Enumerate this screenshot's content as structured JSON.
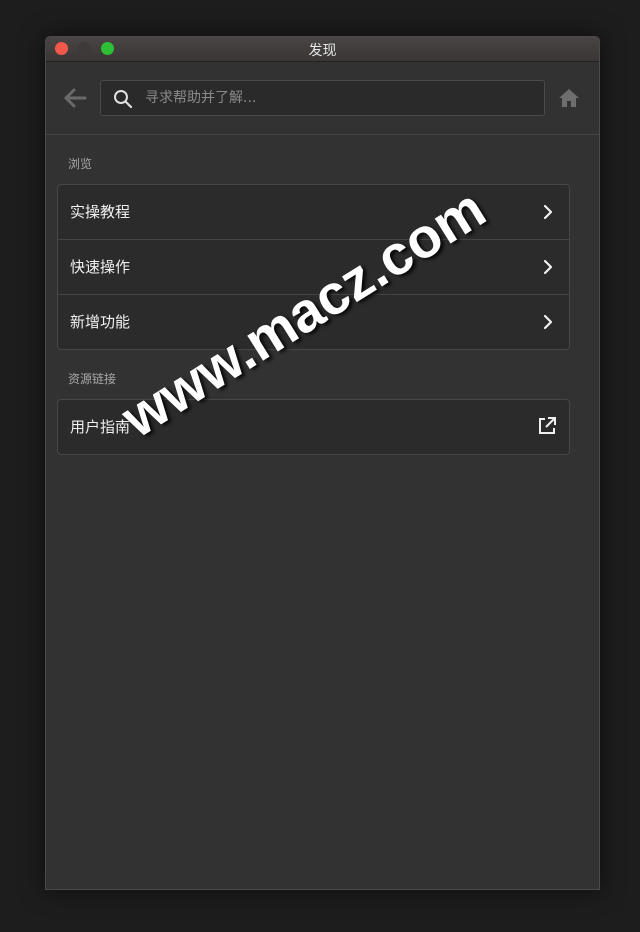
{
  "window": {
    "title": "发现"
  },
  "search": {
    "placeholder": "寻求帮助并了解..."
  },
  "sections": {
    "browse": {
      "label": "浏览",
      "items": [
        {
          "label": "实操教程"
        },
        {
          "label": "快速操作"
        },
        {
          "label": "新增功能"
        }
      ]
    },
    "resources": {
      "label": "资源链接",
      "items": [
        {
          "label": "用户指南"
        }
      ]
    }
  },
  "watermark": "www.macz.com",
  "colors": {
    "window_bg": "#323232",
    "card_bg": "#2b2b2b",
    "close": "#f2584a",
    "zoom": "#2fbf34"
  }
}
